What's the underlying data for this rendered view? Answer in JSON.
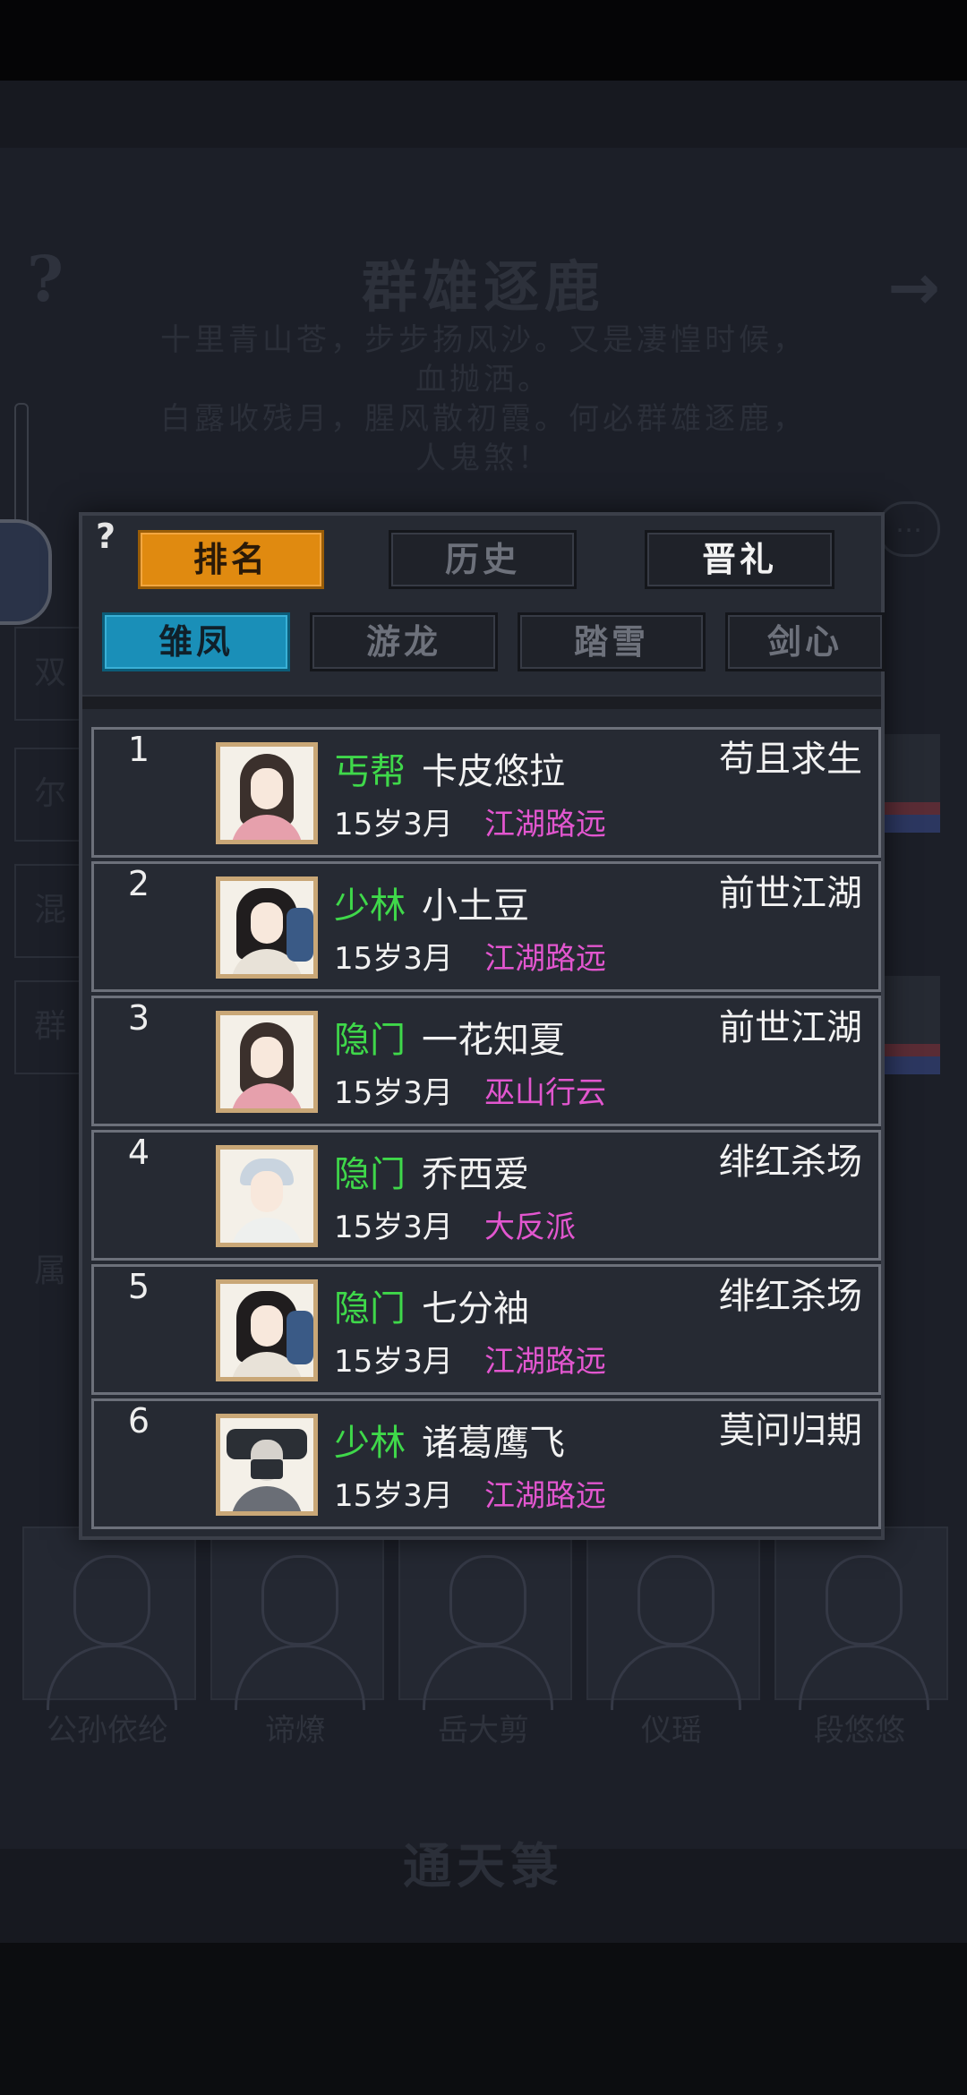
{
  "background": {
    "help_symbol": "?",
    "arrow_symbol": "→",
    "title": "群雄逐鹿",
    "poem_lines": [
      "十里青山苍，步步扬风沙。又是凄惶时候，",
      "血抛洒。",
      "白露收残月，腥风散初霞。何必群雄逐鹿，",
      "人鬼煞！"
    ],
    "left_labels": [
      "双",
      "尔",
      "混",
      "群"
    ],
    "attr_label": "属",
    "portrait_names": [
      "公孙依纶",
      "谛燎",
      "岳大剪",
      "仪瑶",
      "段悠悠"
    ],
    "bottom_title": "通天箓"
  },
  "modal": {
    "help_symbol": "?",
    "main_tabs": [
      {
        "label": "排名",
        "active": true
      },
      {
        "label": "历史",
        "active": false
      },
      {
        "label": "晋礼",
        "active": false
      }
    ],
    "sub_tabs": [
      {
        "label": "雏凤",
        "active": true
      },
      {
        "label": "游龙",
        "active": false
      },
      {
        "label": "踏雪",
        "active": false
      },
      {
        "label": "剑心",
        "active": false
      }
    ],
    "rows": [
      {
        "rank": "1",
        "sect": "丐帮",
        "name": "卡皮悠拉",
        "age": "15岁3月",
        "guild": "江湖路远",
        "server": "苟且求生",
        "avatar": "avatar-lady-icon"
      },
      {
        "rank": "2",
        "sect": "少林",
        "name": "小土豆",
        "age": "15岁3月",
        "guild": "江湖路远",
        "server": "前世江湖",
        "avatar": "avatar-fan-lady-icon"
      },
      {
        "rank": "3",
        "sect": "隐门",
        "name": "一花知夏",
        "age": "15岁3月",
        "guild": "巫山行云",
        "server": "前世江湖",
        "avatar": "avatar-lady-icon"
      },
      {
        "rank": "4",
        "sect": "隐门",
        "name": "乔西爱",
        "age": "15岁3月",
        "guild": "大反派",
        "server": "绯红杀场",
        "avatar": "avatar-scholar-icon"
      },
      {
        "rank": "5",
        "sect": "隐门",
        "name": "七分袖",
        "age": "15岁3月",
        "guild": "江湖路远",
        "server": "绯红杀场",
        "avatar": "avatar-fan-lady-icon"
      },
      {
        "rank": "6",
        "sect": "少林",
        "name": "诸葛鹰飞",
        "age": "15岁3月",
        "guild": "江湖路远",
        "server": "莫问归期",
        "avatar": "avatar-masked-icon"
      }
    ]
  },
  "colors": {
    "sect": "#3fd84a",
    "guild": "#e256cf",
    "active_main_tab": "#e08a10",
    "active_sub_tab": "#1a8fb8"
  }
}
